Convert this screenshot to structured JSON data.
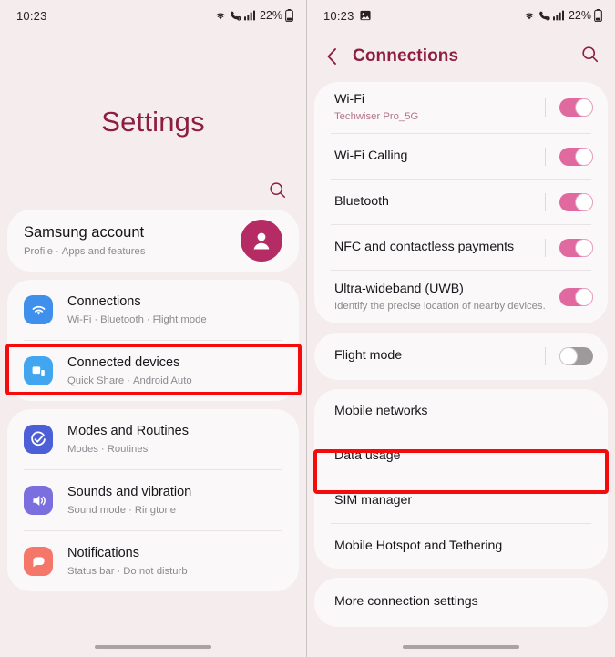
{
  "theme": {
    "accent": "#8e1d42",
    "toggle_on": "#e069a0",
    "toggle_off": "#9e9a9c",
    "highlight": "#f50b0b",
    "background": "#f4eced",
    "card": "#fbf8f9"
  },
  "left_phone": {
    "statusbar": {
      "time": "10:23",
      "battery_text": "22%",
      "icons": [
        "wifi-icon",
        "call-signal-icon",
        "cellular-icon",
        "battery-icon"
      ]
    },
    "page_title": "Settings",
    "search_icon": "search-icon",
    "account": {
      "title": "Samsung account",
      "subtitle_parts": [
        "Profile",
        "Apps and features"
      ],
      "avatar": "person-avatar-icon"
    },
    "items": [
      {
        "title": "Connections",
        "subtitle_parts": [
          "Wi-Fi",
          "Bluetooth",
          "Flight mode"
        ],
        "icon": "wifi-icon",
        "icon_color": "#3f90ec",
        "highlighted": true
      },
      {
        "title": "Connected devices",
        "subtitle_parts": [
          "Quick Share",
          "Android Auto"
        ],
        "icon": "devices-icon",
        "icon_color": "#41a5ef",
        "highlighted": false
      },
      {
        "title": "Modes and Routines",
        "subtitle_parts": [
          "Modes",
          "Routines"
        ],
        "icon": "modes-routines-icon",
        "icon_color": "#4c5fd7",
        "highlighted": false
      },
      {
        "title": "Sounds and vibration",
        "subtitle_parts": [
          "Sound mode",
          "Ringtone"
        ],
        "icon": "speaker-icon",
        "icon_color": "#7b6ede",
        "highlighted": false
      },
      {
        "title": "Notifications",
        "subtitle_parts": [
          "Status bar",
          "Do not disturb"
        ],
        "icon": "notification-bubble-icon",
        "icon_color": "#f4776a",
        "highlighted": false
      }
    ]
  },
  "right_phone": {
    "statusbar": {
      "time": "10:23",
      "battery_text": "22%",
      "icons": [
        "image-icon",
        "wifi-icon",
        "call-signal-icon",
        "cellular-icon",
        "battery-icon"
      ]
    },
    "appbar": {
      "back_icon": "back-chevron-icon",
      "title": "Connections",
      "search_icon": "search-icon"
    },
    "group1": [
      {
        "title": "Wi-Fi",
        "subtitle": "Techwiser Pro_5G",
        "toggle": "on"
      },
      {
        "title": "Wi-Fi Calling",
        "subtitle": "",
        "toggle": "on"
      },
      {
        "title": "Bluetooth",
        "subtitle": "",
        "toggle": "on"
      },
      {
        "title": "NFC and contactless payments",
        "subtitle": "",
        "toggle": "on"
      },
      {
        "title": "Ultra-wideband (UWB)",
        "subtitle": "Identify the precise location of nearby devices.",
        "toggle": "on"
      }
    ],
    "group2": [
      {
        "title": "Flight mode",
        "subtitle": "",
        "toggle": "off"
      }
    ],
    "group3": [
      {
        "title": "Mobile networks",
        "highlighted": false
      },
      {
        "title": "Data usage",
        "highlighted": true
      },
      {
        "title": "SIM manager",
        "highlighted": false
      },
      {
        "title": "Mobile Hotspot and Tethering",
        "highlighted": false
      }
    ],
    "group4": [
      {
        "title": "More connection settings",
        "highlighted": false
      }
    ]
  }
}
